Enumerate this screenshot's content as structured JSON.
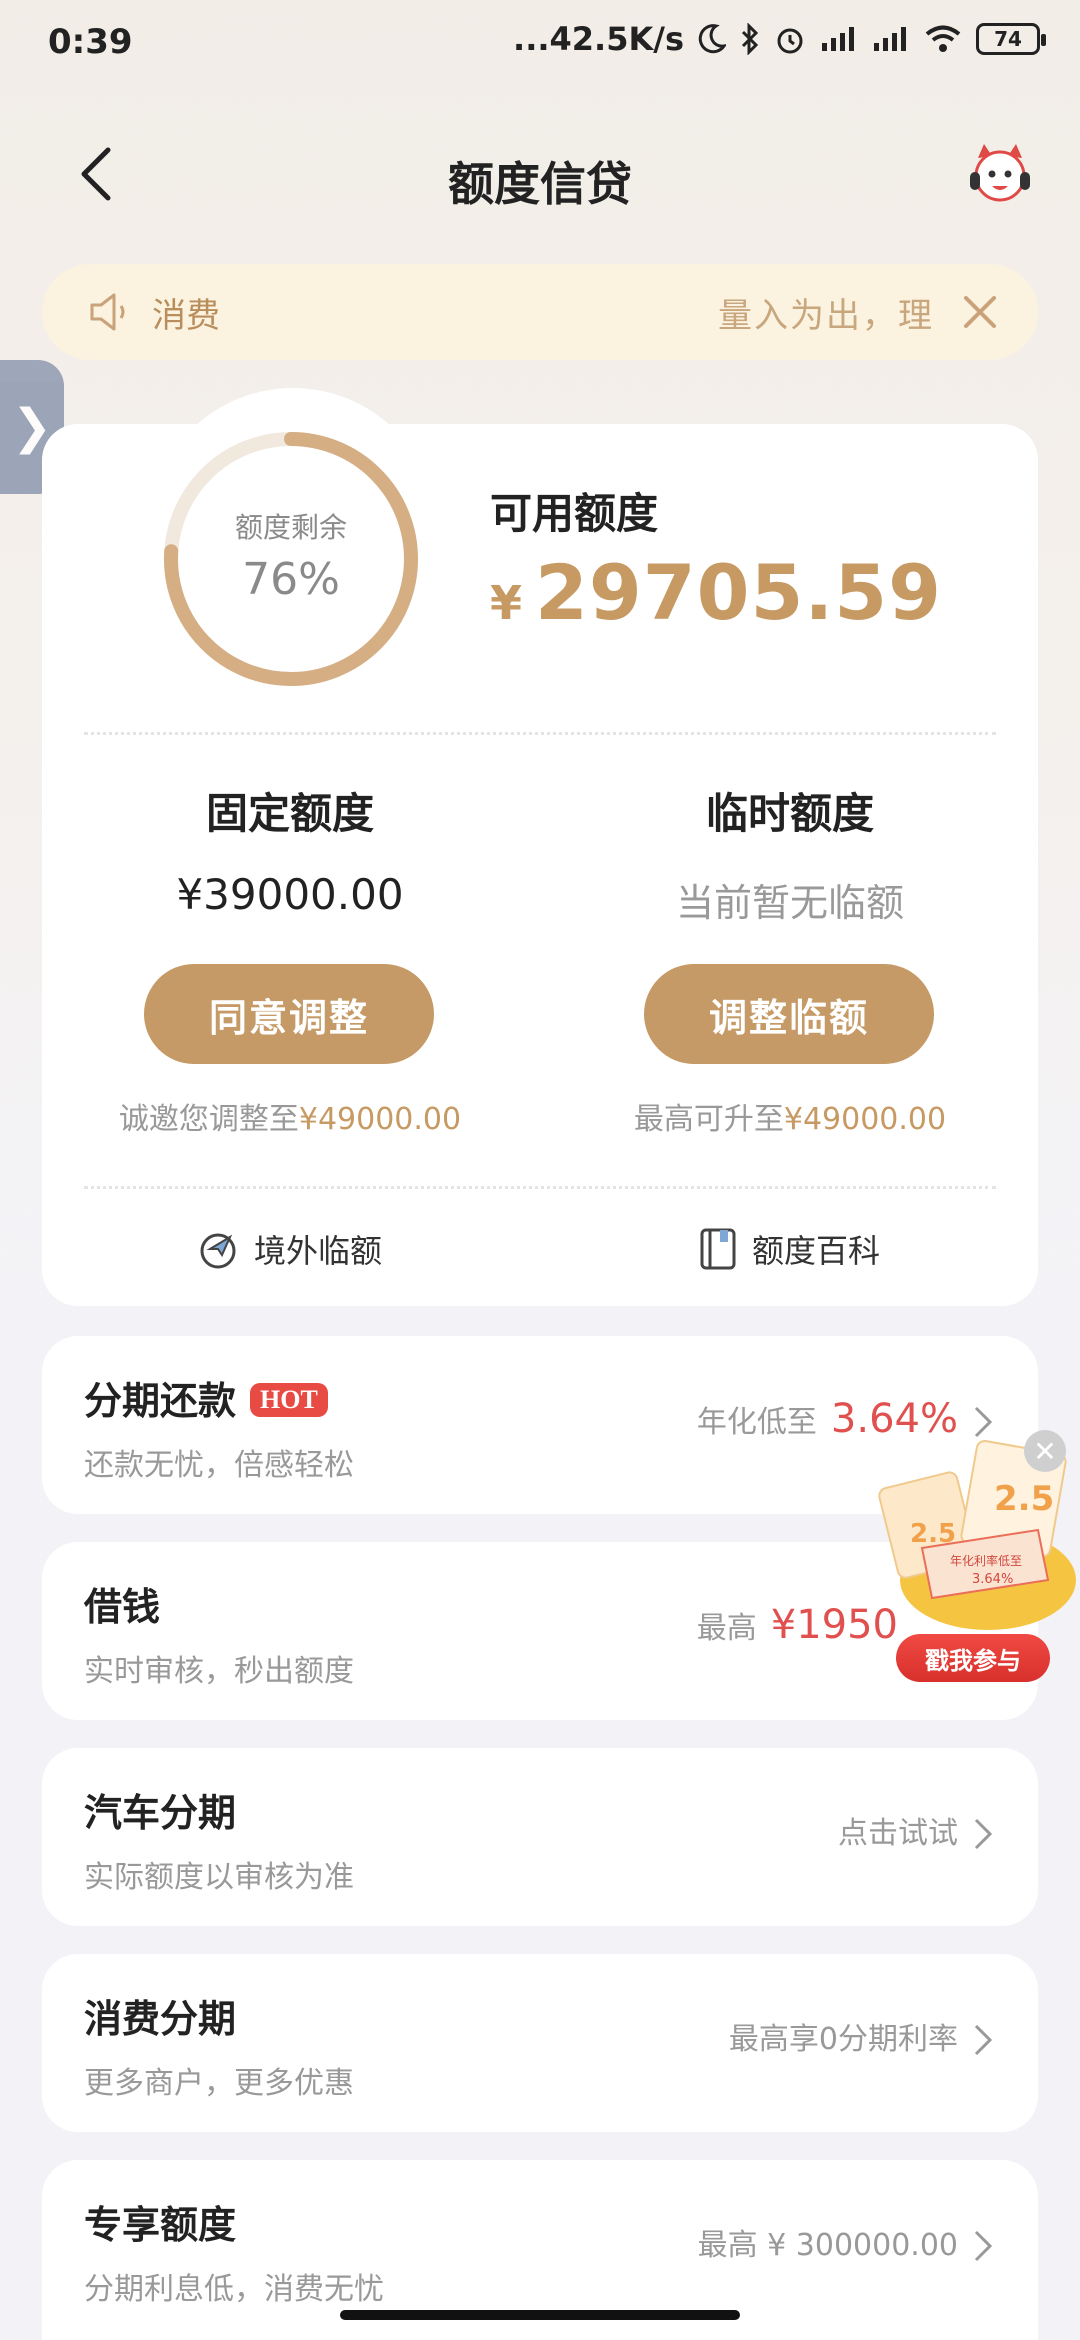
{
  "status_bar": {
    "time": "0:39",
    "net_speed": "...42.5K/s",
    "battery": "74"
  },
  "header": {
    "title": "额度信贷"
  },
  "notice": {
    "left_text": "消费",
    "right_text": "量入为出，理"
  },
  "side_tab": {
    "glyph": "❯"
  },
  "credit": {
    "ring_label": "额度剩余",
    "ring_percent": "76%",
    "ring_fraction": 0.76,
    "available_label": "可用额度",
    "available_currency": "¥",
    "available_amount": "29705.59",
    "fixed": {
      "label": "固定额度",
      "amount": "¥39000.00",
      "button": "同意调整",
      "note_prefix": "诚邀您调整至",
      "note_amount": "¥49000.00"
    },
    "temp": {
      "label": "临时额度",
      "amount": "当前暂无临额",
      "button": "调整临额",
      "note_prefix": "最高可升至",
      "note_amount": "¥49000.00"
    },
    "links": {
      "overseas": "境外临额",
      "encyclopedia": "额度百科"
    }
  },
  "rows": [
    {
      "title": "分期还款",
      "badge": "HOT",
      "subtitle": "还款无忧，倍感轻松",
      "right_prefix": "年化低至",
      "right_highlight": "3.64%"
    },
    {
      "title": "借钱",
      "subtitle": "实时审核，秒出额度",
      "right_prefix": "最高",
      "right_highlight": "¥1950"
    },
    {
      "title": "汽车分期",
      "subtitle": "实际额度以审核为准",
      "right_text": "点击试试"
    },
    {
      "title": "消费分期",
      "subtitle": "更多商户，更多优惠",
      "right_text": "最高享0分期利率"
    },
    {
      "title": "专享额度",
      "subtitle": "分期利息低，消费无忧",
      "right_text": "最高 ¥ 300000.00"
    }
  ],
  "promo": {
    "button": "戳我参与",
    "big_text": "2.5",
    "small_text": "年化利率低至",
    "rate": "3.64%"
  },
  "colors": {
    "gold": "#c59a66",
    "red": "#e0504e",
    "notice_bg": "#fbf3df"
  }
}
